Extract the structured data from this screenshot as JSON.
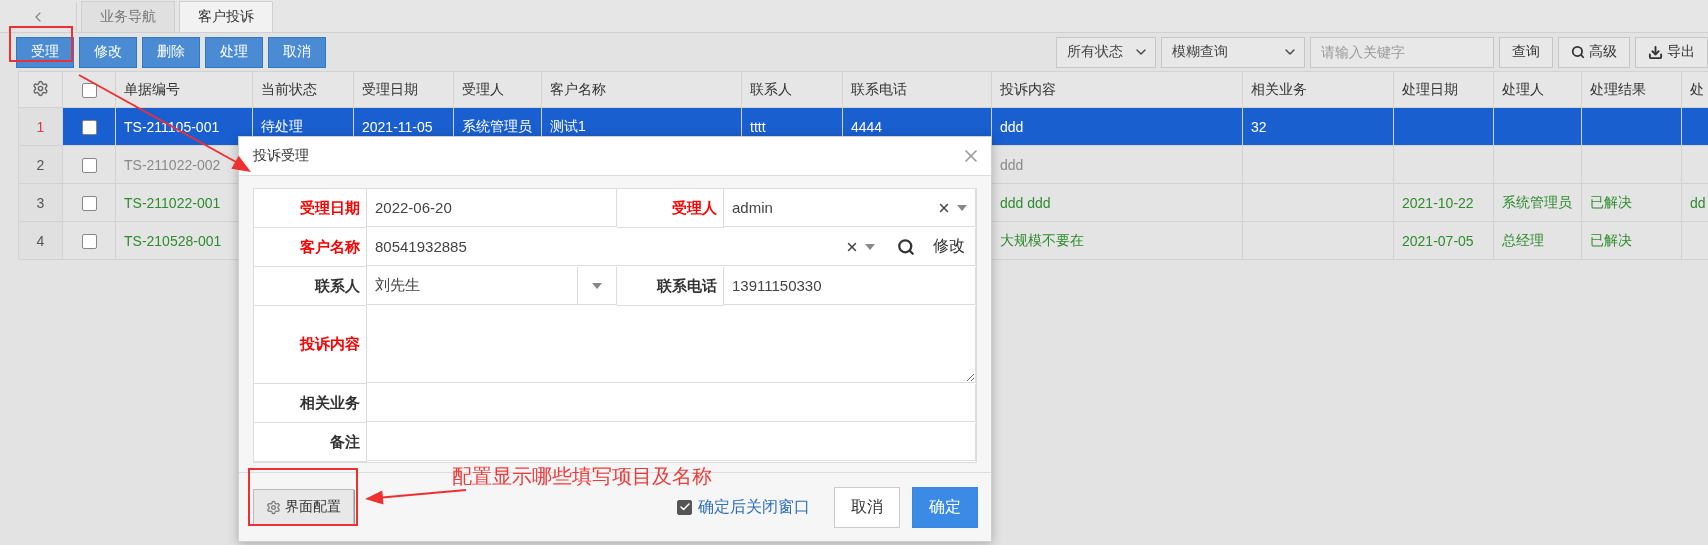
{
  "tabs": [
    {
      "label": "业务导航",
      "selected": false
    },
    {
      "label": "客户投诉",
      "selected": true
    }
  ],
  "toolbar": {
    "actions": [
      "受理",
      "修改",
      "删除",
      "处理",
      "取消"
    ],
    "status_select": "所有状态",
    "mode_select": "模糊查询",
    "search": {
      "placeholder": "请输入关键字"
    },
    "buttons": [
      {
        "label": "查询",
        "kind": "plain"
      },
      {
        "label": "高级",
        "kind": "search"
      },
      {
        "label": "导出",
        "kind": "export"
      }
    ]
  },
  "table": {
    "all_checked": false,
    "columns": [
      "单据编号",
      "当前状态",
      "受理日期",
      "受理人",
      "客户名称",
      "联系人",
      "联系电话",
      "投诉内容",
      "相关业务",
      "处理日期",
      "处理人",
      "处理结果",
      "处"
    ],
    "rows": [
      {
        "number": "1",
        "selected": true,
        "checked": false,
        "cells": [
          "TS-211105-001",
          "待处理",
          "2021-11-05",
          "系统管理员",
          "测试1",
          "tttt",
          "4444",
          "ddd",
          "32",
          null,
          null,
          null,
          null
        ]
      },
      {
        "number": "2",
        "selected": false,
        "checked": false,
        "color": "#8a8a8a",
        "cells": [
          "TS-211022-002",
          null,
          null,
          null,
          null,
          null,
          null,
          "ddd",
          null,
          null,
          null,
          null,
          null
        ]
      },
      {
        "number": "3",
        "selected": false,
        "checked": false,
        "color": "#2e8b2e",
        "cells": [
          "TS-211022-001",
          null,
          null,
          null,
          null,
          null,
          null,
          "ddd ddd",
          null,
          "2021-10-22",
          "系统管理员",
          "已解决",
          "dd"
        ]
      },
      {
        "number": "4",
        "selected": false,
        "checked": false,
        "color": "#2e8b2e",
        "cells": [
          "TS-210528-001",
          null,
          null,
          null,
          null,
          null,
          null,
          "大规模不要在",
          null,
          "2021-07-05",
          "总经理",
          "已解决",
          null
        ]
      }
    ]
  },
  "dialog": {
    "title": "投诉受理",
    "rows": [
      [
        {
          "label": "受理日期",
          "required": true,
          "kind": "text",
          "value": "2022-06-20"
        },
        {
          "label": "受理人",
          "required": true,
          "kind": "select",
          "value": "admin"
        }
      ],
      [
        {
          "label": "客户名称",
          "required": true,
          "kind": "lookup",
          "value": "80541932885",
          "action": "修改"
        }
      ],
      [
        {
          "label": "联系人",
          "required": false,
          "kind": "combo",
          "value": "刘先生"
        },
        {
          "label": "联系电话",
          "required": false,
          "kind": "text",
          "value": "13911150330"
        }
      ],
      [
        {
          "label": "投诉内容",
          "required": true,
          "kind": "textarea"
        }
      ],
      [
        {
          "label": "相关业务",
          "required": false,
          "kind": "text"
        }
      ],
      [
        {
          "label": "备注",
          "required": false,
          "kind": "text"
        }
      ]
    ],
    "config_button": "界面配置",
    "close_after_confirm": {
      "label": "确定后关闭窗口",
      "checked": true
    },
    "buttons": [
      {
        "label": "取消",
        "kind": "default"
      },
      {
        "label": "确定",
        "kind": "primary"
      }
    ]
  },
  "annotation": {
    "note": "配置显示哪些填写项目及名称"
  }
}
